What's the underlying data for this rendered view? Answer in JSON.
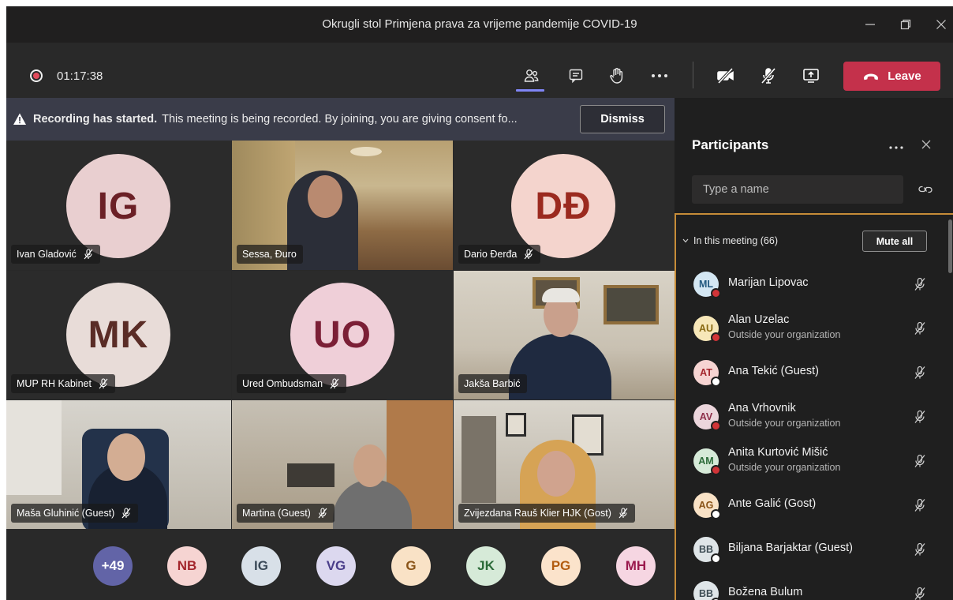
{
  "window": {
    "title": "Okrugli stol Primjena prava za vrijeme pandemije COVID-19"
  },
  "toolbar": {
    "timer": "01:17:38",
    "leave_label": "Leave"
  },
  "banner": {
    "bold": "Recording has started.",
    "text": "This meeting is being recorded. By joining, you are giving consent fo...",
    "dismiss_label": "Dismiss"
  },
  "tiles": [
    {
      "name": "Ivan Gladović",
      "initials": "IG",
      "color": "#e9cfd0",
      "muted": true
    },
    {
      "name": "Sessa, Đuro",
      "video": true,
      "muted": false
    },
    {
      "name": "Dario Đerđa",
      "initials": "DĐ",
      "color": "#f4d4cd",
      "muted": true
    },
    {
      "name": "MUP RH Kabinet",
      "initials": "MK",
      "color": "#e8dcd8",
      "muted": true
    },
    {
      "name": "Ured Ombudsman",
      "initials": "UO",
      "color": "#efcfd8",
      "muted": true
    },
    {
      "name": "Jakša Barbić",
      "video": true,
      "muted": false
    },
    {
      "name": "Maša Gluhinić (Guest)",
      "video": true,
      "muted": true
    },
    {
      "name": "Martina (Guest)",
      "video": true,
      "muted": true
    },
    {
      "name": "Zvijezdana Rauš Klier HJK (Gost)",
      "video": true,
      "muted": true
    }
  ],
  "overflow": [
    {
      "label": "+49",
      "bg": "#6264a7",
      "fg": "#ffffff"
    },
    {
      "label": "NB",
      "bg": "#f6d4d2",
      "fg": "#a4262c"
    },
    {
      "label": "IG",
      "bg": "#d8e0e8",
      "fg": "#3b4a58"
    },
    {
      "label": "VG",
      "bg": "#dcd8ef",
      "fg": "#4a3e8a"
    },
    {
      "label": "G",
      "bg": "#f9e2c6",
      "fg": "#8a5418"
    },
    {
      "label": "JK",
      "bg": "#d6ead8",
      "fg": "#2c6b39"
    },
    {
      "label": "PG",
      "bg": "#fbe3cb",
      "fg": "#b35c10"
    },
    {
      "label": "MH",
      "bg": "#f6d6e2",
      "fg": "#9b1a4e"
    }
  ],
  "panel": {
    "title": "Participants",
    "search_placeholder": "Type a name",
    "section_label": "In this meeting (66)",
    "mute_all_label": "Mute all",
    "participants": [
      {
        "initials": "ML",
        "name": "Marijan Lipovac",
        "sub": "",
        "bg": "#d4e7f3",
        "fg": "#235a80",
        "status": "red"
      },
      {
        "initials": "AU",
        "name": "Alan Uzelac",
        "sub": "Outside your organization",
        "bg": "#f7e7b8",
        "fg": "#8a6a12",
        "status": "red"
      },
      {
        "initials": "AT",
        "name": "Ana Tekić (Guest)",
        "sub": "",
        "bg": "#f6d4d2",
        "fg": "#a4262c",
        "status": "white"
      },
      {
        "initials": "AV",
        "name": "Ana Vrhovnik",
        "sub": "Outside your organization",
        "bg": "#ecd6dc",
        "fg": "#8e2f4a",
        "status": "red"
      },
      {
        "initials": "AM",
        "name": "Anita Kurtović Mišić",
        "sub": "Outside your organization",
        "bg": "#d6ead8",
        "fg": "#2c6b39",
        "status": "red"
      },
      {
        "initials": "AG",
        "name": "Ante Galić (Gost)",
        "sub": "",
        "bg": "#f9e2c6",
        "fg": "#8a5418",
        "status": "white"
      },
      {
        "initials": "BB",
        "name": "Biljana Barjaktar (Guest)",
        "sub": "",
        "bg": "#dfe5e8",
        "fg": "#3e4d55",
        "status": "white"
      },
      {
        "initials": "BB",
        "name": "Božena Bulum",
        "sub": "",
        "bg": "#dfe5e8",
        "fg": "#3e4d55",
        "status": "white"
      }
    ]
  }
}
